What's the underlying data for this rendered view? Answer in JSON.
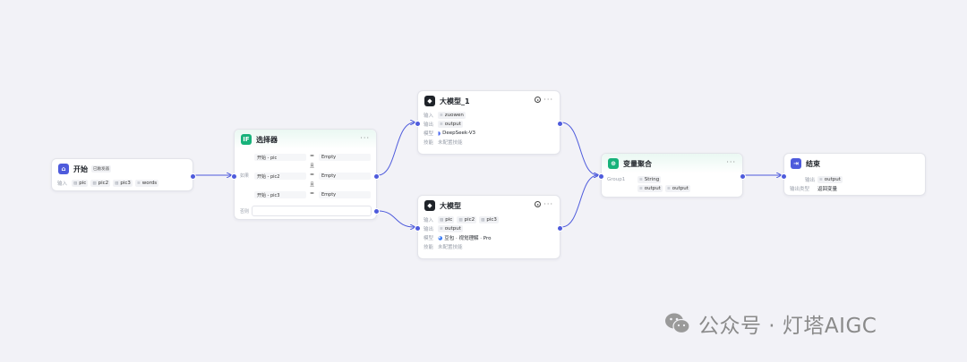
{
  "start": {
    "title": "开始",
    "badge": "已触发器",
    "input_label": "输入",
    "inputs": [
      "pic",
      "pic2",
      "pic3",
      "words"
    ]
  },
  "selector": {
    "title": "选择器",
    "if_label": "如果",
    "else_label": "否则",
    "conditions": [
      {
        "left": "开始 - pic",
        "op": "=",
        "right": "Empty"
      },
      {
        "left": "开始 - pic2",
        "op": "=",
        "right": "Empty"
      },
      {
        "left": "开始 - pic3",
        "op": "=",
        "right": "Empty"
      }
    ],
    "join": "且"
  },
  "llm1": {
    "title": "大模型_1",
    "input_label": "输入",
    "inputs": [
      "zuowen"
    ],
    "output_label": "输出",
    "outputs": [
      "output"
    ],
    "model_label": "模型",
    "model": "DeepSeek-V3",
    "skill_label": "技能",
    "skill": "未配置技能"
  },
  "llm2": {
    "title": "大模型",
    "input_label": "输入",
    "inputs": [
      "pic",
      "pic2",
      "pic3"
    ],
    "output_label": "输出",
    "outputs": [
      "output"
    ],
    "model_label": "模型",
    "model": "豆包 · 视觉理解 · Pro",
    "skill_label": "技能",
    "skill": "未配置技能"
  },
  "aggregate": {
    "title": "变量聚合",
    "group_label": "Group1",
    "group_type": "String",
    "outputs": [
      "output",
      "output"
    ]
  },
  "end": {
    "title": "结束",
    "output_label": "输出",
    "outputs": [
      "output"
    ],
    "mode_label": "输出类型",
    "mode": "返回变量"
  },
  "watermark": "公众号 · 灯塔AIGC",
  "colors": {
    "accent": "#4e5bdc",
    "start_icon": "#4e5bdc",
    "selector_icon": "#17b27a",
    "aggregate_icon": "#17b27a",
    "end_icon": "#4e5bdc",
    "edge": "#4e5bdc"
  }
}
